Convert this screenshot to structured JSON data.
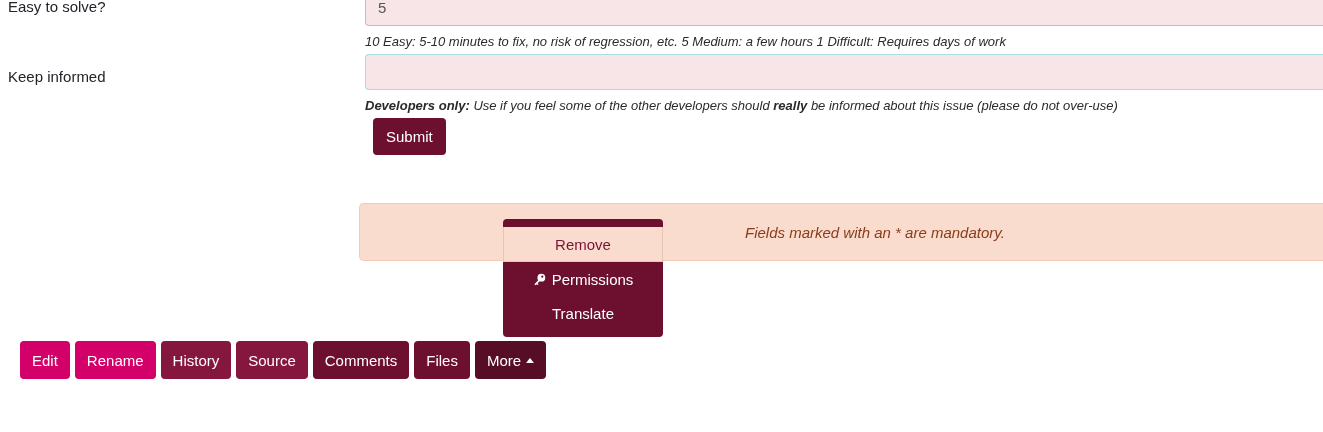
{
  "form": {
    "fields": [
      {
        "label": "Easy to solve?",
        "value": "5",
        "focused": false,
        "help": "10 Easy: 5-10 minutes to fix, no risk of regression, etc. 5 Medium: a few hours 1 Difficult: Requires days of work"
      },
      {
        "label": "Keep informed",
        "focused": true,
        "help": "**Developers only:** Use if you feel some of the other developers should **really** be informed about this issue (please do not over-use)"
      }
    ],
    "submit": "Submit"
  },
  "alert": "Fields marked with an * are mandatory.",
  "toolbar": [
    {
      "label": "Edit",
      "color": "#d4006a",
      "expanded": false
    },
    {
      "label": "Rename",
      "color": "#d4006a",
      "expanded": false
    },
    {
      "label": "History",
      "color": "#85163e",
      "expanded": false
    },
    {
      "label": "Source",
      "color": "#85163e",
      "expanded": false
    },
    {
      "label": "Comments",
      "color": "#6d1030",
      "expanded": false
    },
    {
      "label": "Files",
      "color": "#6d1030",
      "expanded": false
    },
    {
      "label": "More",
      "color": "#560d25",
      "expanded": true
    }
  ],
  "menu": [
    {
      "label": "Remove",
      "selected": true,
      "icon": false
    },
    {
      "label": "Permissions",
      "selected": false,
      "icon": true
    },
    {
      "label": "Translate",
      "selected": false,
      "icon": false
    }
  ]
}
